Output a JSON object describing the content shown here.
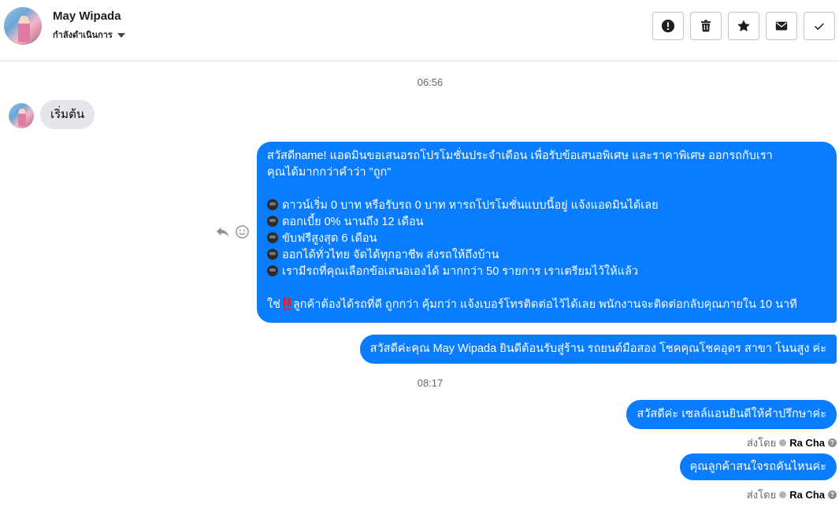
{
  "header": {
    "contact_name": "May Wipada",
    "status_label": "กำลังดำเนินการ",
    "toolbar": [
      {
        "icon": "alert-icon",
        "name": "mark-spam-button"
      },
      {
        "icon": "trash-icon",
        "name": "delete-button"
      },
      {
        "icon": "star-icon",
        "name": "star-button"
      },
      {
        "icon": "envelope-icon",
        "name": "mark-unread-button"
      },
      {
        "icon": "check-icon",
        "name": "mark-done-button"
      }
    ]
  },
  "conversation": {
    "time_1": "06:56",
    "incoming_message": "เริ่มต้น",
    "promo": {
      "intro_1": "สวัสดีname! แอดมินขอเสนอรถโปรโมชั่นประจำเดือน เพื่อรับข้อเสนอพิเศษ และราคาพิเศษ ออกรถกับเรา",
      "intro_2": "คุณได้มากกว่าคำว่า \"ถูก\"",
      "bullets": [
        "ดาวน์เริ่ม 0 บาท หรือรับรถ 0 บาท หารถโปรโมชั่นแบบนี้อยู่ แจ้งแอดมินได้เลย",
        "ดอกเบี้ย 0% นานถึง 12 เดือน",
        "ขับฟรีสูงสุด 6 เดือน",
        "ออกได้ทั่วไทย จัดได้ทุกอาชีพ ส่งรถให้ถึงบ้าน",
        "เรามีรถที่คุณเลือกข้อเสนอเองได้ มากกว่า 50 รายการ เราเตรียมไว้ให้แล้ว"
      ],
      "closing_prefix": "ใช่",
      "closing_text": "ลูกค้าต้องได้รถที่ดี ถูกกว่า คุ้มกว่า แจ้งเบอร์โทรติดต่อไว้ได้เลย พนักงานจะติดต่อกลับคุณภายใน 10 นาที"
    },
    "welcome_message": "สวัสดีค่ะคุณ May Wipada ยินดีต้อนรับสู่ร้าน รถยนต์มือสอง โชคคุณโชคอุดร สาขา โนนสูง ค่ะ",
    "time_2": "08:17",
    "reply_1": "สวัสดีค่ะ เซลล์แอนยินดีให้คำปรึกษาค่ะ",
    "reply_2": "คุณลูกค้าสนใจรถคันไหนค่ะ",
    "sent_by_label": "ส่งโดย",
    "sender_name": "Ra Cha",
    "help_glyph": "?"
  },
  "colors": {
    "outgoing_bubble": "#0a7cff",
    "incoming_bubble": "#e4e6eb",
    "meta_text": "#65676b"
  }
}
